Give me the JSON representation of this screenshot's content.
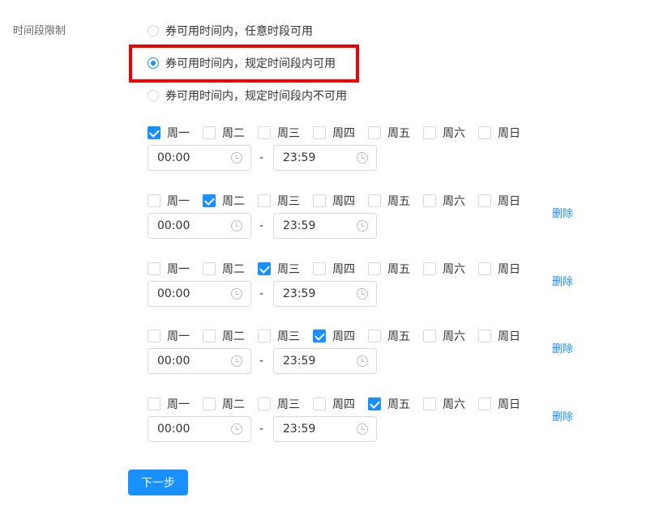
{
  "field_label": "时间段限制",
  "radio_options": [
    {
      "label": "券可用时间内，任意时段可用",
      "checked": false
    },
    {
      "label": "券可用时间内，规定时间段内可用",
      "checked": true
    },
    {
      "label": "券可用时间内，规定时间段内不可用",
      "checked": false
    }
  ],
  "weekdays": [
    "周一",
    "周二",
    "周三",
    "周四",
    "周五",
    "周六",
    "周日"
  ],
  "rules": [
    {
      "checked": [
        true,
        false,
        false,
        false,
        false,
        false,
        false
      ],
      "start": "00:00",
      "end": "23:59",
      "separator": "-",
      "delete_label": ""
    },
    {
      "checked": [
        false,
        true,
        false,
        false,
        false,
        false,
        false
      ],
      "start": "00:00",
      "end": "23:59",
      "separator": "-",
      "delete_label": "删除"
    },
    {
      "checked": [
        false,
        false,
        true,
        false,
        false,
        false,
        false
      ],
      "start": "00:00",
      "end": "23:59",
      "separator": "-",
      "delete_label": "删除"
    },
    {
      "checked": [
        false,
        false,
        false,
        true,
        false,
        false,
        false
      ],
      "start": "00:00",
      "end": "23:59",
      "separator": "-",
      "delete_label": "删除"
    },
    {
      "checked": [
        false,
        false,
        false,
        false,
        true,
        false,
        false
      ],
      "start": "00:00",
      "end": "23:59",
      "separator": "-",
      "delete_label": "删除"
    }
  ],
  "next_button_label": "下一步",
  "colors": {
    "accent": "#1890ff",
    "highlight": "#ee0000"
  }
}
